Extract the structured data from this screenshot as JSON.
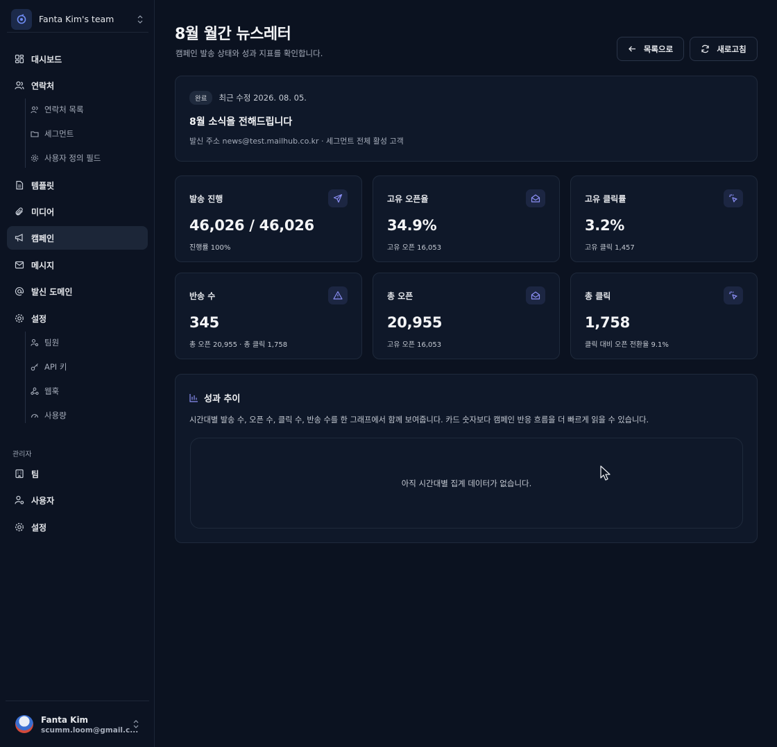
{
  "team": {
    "name": "Fanta Kim's team"
  },
  "nav": {
    "dashboard": "대시보드",
    "contacts": "연락처",
    "contacts_sub": [
      "연락처 목록",
      "세그먼트",
      "사용자 정의 필드"
    ],
    "templates": "템플릿",
    "media": "미디어",
    "campaigns": "캠페인",
    "messages": "메시지",
    "domains": "발신 도메인",
    "settings": "설정",
    "settings_sub": [
      "팀원",
      "API 키",
      "웹훅",
      "사용량"
    ],
    "admin_label": "관리자",
    "admin_team": "팀",
    "admin_users": "사용자",
    "admin_settings": "설정"
  },
  "user": {
    "name": "Fanta Kim",
    "email": "scumm.loom@gmail.c..."
  },
  "page": {
    "title": "8월 월간 뉴스레터",
    "subtitle": "캠페인 발송 상태와 성과 지표를 확인합니다.",
    "back_label": "목록으로",
    "refresh_label": "새로고침"
  },
  "summary": {
    "status": "완료",
    "modified": "최근 수정 2026. 08. 05.",
    "subject": "8월 소식을 전해드립니다",
    "meta": "발신 주소 news@test.mailhub.co.kr · 세그먼트 전체 활성 고객"
  },
  "stats": [
    {
      "label": "발송 진행",
      "value": "46,026 / 46,026",
      "sub": "진행률 100%",
      "icon": "send-icon"
    },
    {
      "label": "고유 오픈율",
      "value": "34.9%",
      "sub": "고유 오픈 16,053",
      "icon": "mail-open-icon"
    },
    {
      "label": "고유 클릭률",
      "value": "3.2%",
      "sub": "고유 클릭 1,457",
      "icon": "click-icon"
    },
    {
      "label": "반송 수",
      "value": "345",
      "sub": "총 오픈 20,955 · 총 클릭 1,758",
      "icon": "warning-icon"
    },
    {
      "label": "총 오픈",
      "value": "20,955",
      "sub": "고유 오픈 16,053",
      "icon": "mail-open-icon"
    },
    {
      "label": "총 클릭",
      "value": "1,758",
      "sub": "클릭 대비 오픈 전환율 9.1%",
      "icon": "click-icon"
    }
  ],
  "trend": {
    "title": "성과 추이",
    "description": "시간대별 발송 수, 오픈 수, 클릭 수, 반송 수를 한 그래프에서 함께 보여줍니다. 카드 숫자보다 캠페인 반응 흐름을 더 빠르게 읽을 수 있습니다.",
    "empty": "아직 시간대별 집계 데이터가 없습니다."
  },
  "colors": {
    "accent": "#8b8ff5",
    "background": "#0b1220",
    "card": "#0f1829"
  }
}
